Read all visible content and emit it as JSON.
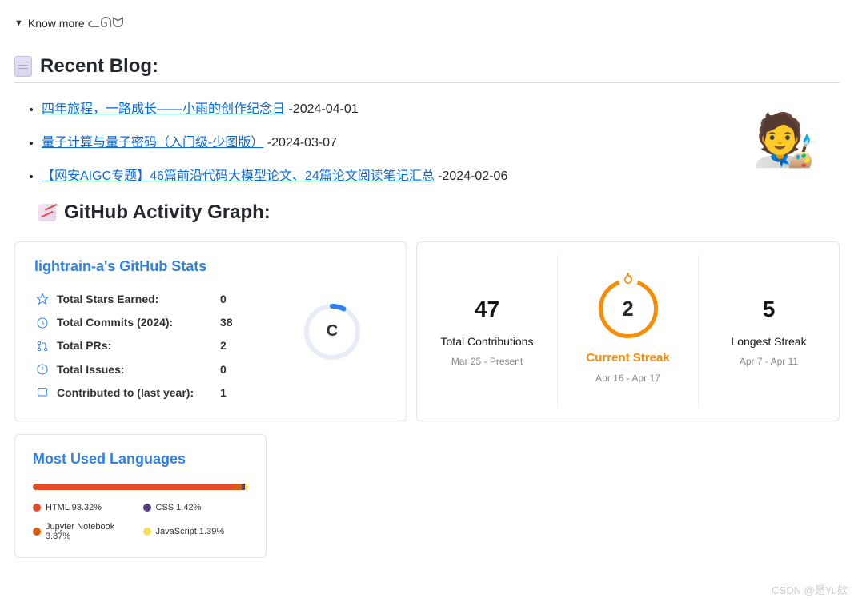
{
  "know_more": {
    "label": "Know more"
  },
  "recent_blog": {
    "title": "Recent Blog:"
  },
  "blogs": [
    {
      "title": "四年旅程，一路成长——小雨的创作纪念日",
      "date": "-2024-04-01"
    },
    {
      "title": "量子计算与量子密码（入门级-少图版）",
      "date": "-2024-03-07"
    },
    {
      "title": "【网安AIGC专题】46篇前沿代码大模型论文、24篇论文阅读笔记汇总",
      "date": "-2024-02-06"
    }
  ],
  "activity": {
    "title": "GitHub Activity Graph:"
  },
  "stats": {
    "title": "lightrain-a's GitHub Stats",
    "rows": [
      {
        "label": "Total Stars Earned:",
        "value": "0"
      },
      {
        "label": "Total Commits (2024):",
        "value": "38"
      },
      {
        "label": "Total PRs:",
        "value": "2"
      },
      {
        "label": "Total Issues:",
        "value": "0"
      },
      {
        "label": "Contributed to (last year):",
        "value": "1"
      }
    ],
    "rank": "C"
  },
  "streak": {
    "total": {
      "value": "47",
      "label": "Total Contributions",
      "sub": "Mar 25 - Present"
    },
    "current": {
      "value": "2",
      "label": "Current Streak",
      "sub": "Apr 16 - Apr 17"
    },
    "longest": {
      "value": "5",
      "label": "Longest Streak",
      "sub": "Apr 7 - Apr 11"
    }
  },
  "languages": {
    "title": "Most Used Languages",
    "items": [
      {
        "name": "HTML 93.32%",
        "color": "#e34c26",
        "pct": 93.32
      },
      {
        "name": "CSS 1.42%",
        "color": "#563d7c",
        "pct": 1.42
      },
      {
        "name": "Jupyter Notebook 3.87%",
        "color": "#DA5B0B",
        "pct": 3.87
      },
      {
        "name": "JavaScript 1.39%",
        "color": "#f1e05a",
        "pct": 1.39
      }
    ]
  },
  "chart_data": [
    {
      "type": "pie",
      "title": "Most Used Languages",
      "series": [
        {
          "name": "HTML",
          "values": [
            93.32
          ]
        },
        {
          "name": "Jupyter Notebook",
          "values": [
            3.87
          ]
        },
        {
          "name": "CSS",
          "values": [
            1.42
          ]
        },
        {
          "name": "JavaScript",
          "values": [
            1.39
          ]
        }
      ]
    }
  ],
  "watermark": "CSDN @是Yu欸"
}
